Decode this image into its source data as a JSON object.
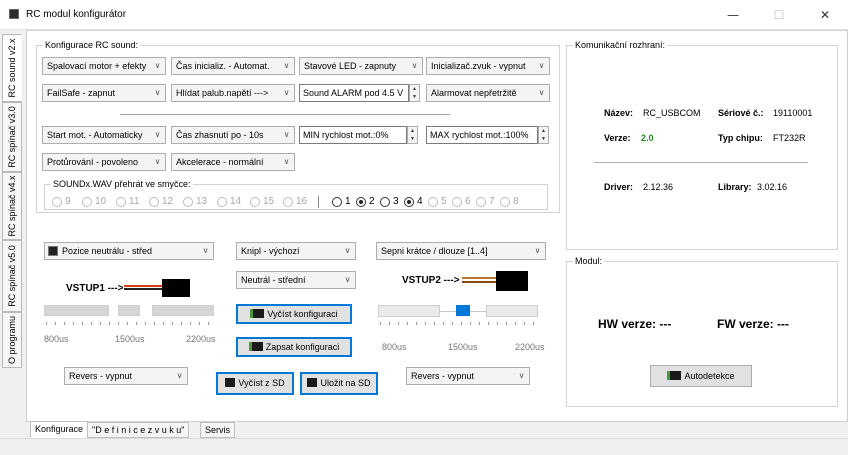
{
  "window": {
    "title": "RC modul konfigurátor",
    "minimize": "—",
    "maximize": "☐",
    "close": "✕"
  },
  "side_tabs": [
    "RC sound v2.x",
    "RC spínač v3.0",
    "RC spínač v4.x",
    "RC spínač v5.0",
    "O programu"
  ],
  "sound_group": {
    "title": "Konfigurace RC sound:",
    "row1": [
      "Spalovací motor + efekty",
      "Čas inicializ. - Automat.",
      "Stavové LED - zapnuty",
      "Inicializač.zvuk - vypnut"
    ],
    "row2": [
      "FailSafe - zapnut",
      "Hlídat palub.napětí --->"
    ],
    "alarm_value": "Sound ALARM pod 4.5 V",
    "row2b": "Alarmovat nepřetržitě",
    "row3": [
      "Start mot. - Automaticky",
      "Čas zhasnutí po - 10s"
    ],
    "min_speed": "MIN rychlost mot.:0%",
    "max_speed": "MAX rychlost mot.:100%",
    "row4": [
      "Protůrování - povoleno",
      "Akcelerace - normální"
    ],
    "loop_label": "SOUNDx.WAV přehrát ve smyčce:",
    "loop_radios": [
      "9",
      "10",
      "11",
      "12",
      "13",
      "14",
      "15",
      "16",
      "1",
      "2",
      "3",
      "4",
      "5",
      "6",
      "7",
      "8"
    ]
  },
  "inputs": {
    "neutral_position": "Pozice neutrálu - střed",
    "knipl": "Knipl - výchozí",
    "neutral_mid": "Neutrál - střední",
    "switch_mode": "Sepni krátce / dlouze [1..4]",
    "input1": "VSTUP1 --->",
    "input2": "VSTUP2 --->",
    "scale": [
      "800us",
      "1500us",
      "2200us"
    ],
    "revers1": "Revers - vypnut",
    "revers2": "Revers - vypnut"
  },
  "buttons": {
    "read_config": "Vyčíst konfiguraci",
    "write_config": "Zapsat konfiguraci",
    "read_sd": "Vyčíst z SD",
    "save_sd": "Uložit na SD",
    "autodetect": "Autodetekce"
  },
  "comm": {
    "title": "Komunikační rozhraní:",
    "name_label": "Název:",
    "name_value": "RC_USBCOM",
    "serial_label": "Sériové č.:",
    "serial_value": "19110001",
    "version_label": "Verze:",
    "version_value": "2.0",
    "chip_label": "Typ chipu:",
    "chip_value": "FT232R",
    "driver_label": "Driver:",
    "driver_value": "2.12.36",
    "library_label": "Library:",
    "library_value": "3.02.16"
  },
  "module": {
    "title": "Modul:",
    "hw": "HW verze:  ---",
    "fw": "FW verze:  ---"
  },
  "bottom_tabs": [
    "Konfigurace",
    "\"D e f i n i c e  z v u k u\"",
    "Servis"
  ],
  "colors": {
    "accent": "#0078d7",
    "version_green": "#1f8a1f"
  }
}
